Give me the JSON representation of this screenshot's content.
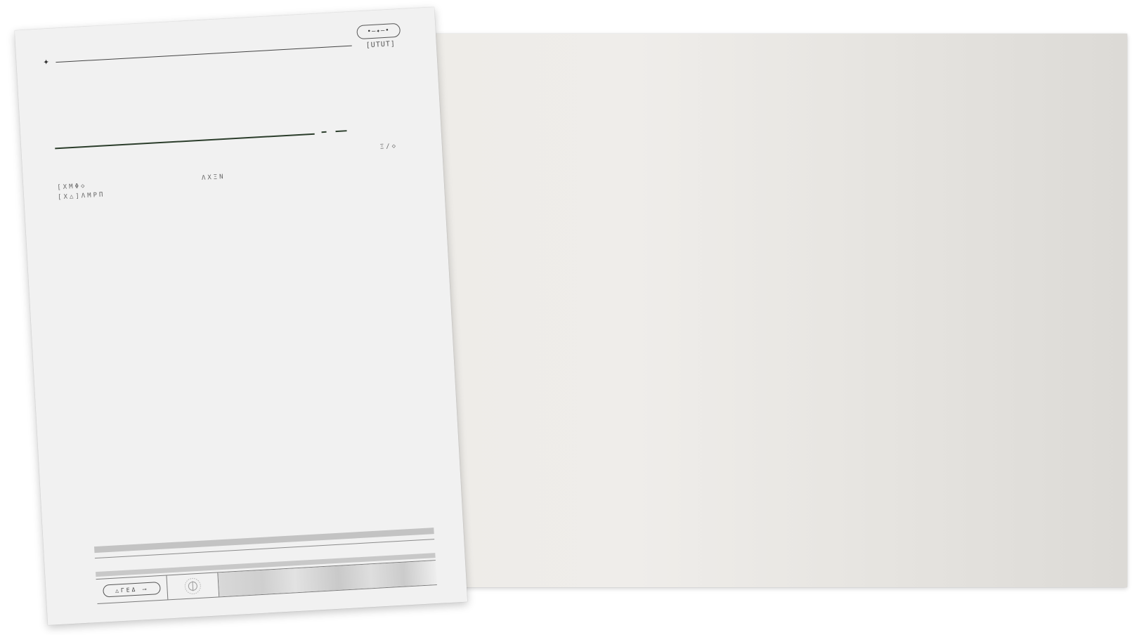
{
  "sheet": {
    "top_star": "✦",
    "top_pill": "•—✦—•",
    "top_code": "[UTUT]",
    "code_right": "Ξ/◇",
    "code_left_1": "[XMΦ◇",
    "code_left_2": "[X△]ΛMPΠ",
    "code_mid": "ΛXΞN",
    "footer_button": "△ΓΕΔ ⟶"
  },
  "colors": {
    "sheet_bg": "#f1f1f1",
    "accent_green": "#2b3d2b",
    "board_bg": "#eeece8"
  }
}
